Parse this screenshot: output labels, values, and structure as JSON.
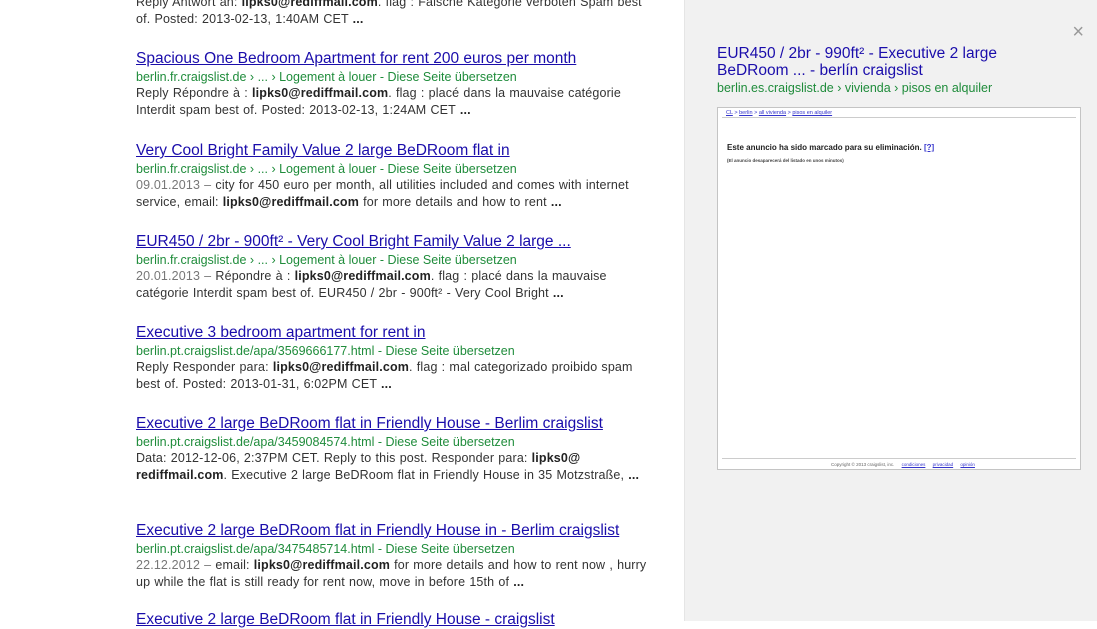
{
  "results": [
    {
      "title": "",
      "url_text": "",
      "translate_label": "",
      "snippet": [
        {
          "t": "Reply Antwort an: "
        },
        {
          "t": "lipks0@rediffmail.com",
          "b": true
        },
        {
          "t": ". flag : Falsche Kategorie verboten Spam best of. Posted: 2013-02-13, 1:40AM CET "
        },
        {
          "t": "...",
          "b": true
        }
      ]
    },
    {
      "title": "Spacious One Bedroom Apartment for rent 200 euros per month",
      "url_text": "berlin.fr.craigslist.de › ... › Logement à louer",
      "translate_label": "Diese Seite übersetzen",
      "snippet": [
        {
          "t": "Reply Répondre à : "
        },
        {
          "t": "lipks0@rediffmail.com",
          "b": true
        },
        {
          "t": ". flag : placé dans la mauvaise catégorie Interdit spam best of. Posted: 2013-02-13, 1:24AM CET "
        },
        {
          "t": "...",
          "b": true
        }
      ]
    },
    {
      "title": "Very Cool Bright Family Value 2 large BeDRoom flat in",
      "url_text": "berlin.fr.craigslist.de › ... › Logement à louer",
      "translate_label": "Diese Seite übersetzen",
      "snippet": [
        {
          "t": "09.01.2013 – ",
          "d": true
        },
        {
          "t": "city for 450 euro per month, all utilities included and comes with internet service, email: "
        },
        {
          "t": "lipks0@rediffmail.com",
          "b": true
        },
        {
          "t": " for more details and how to rent "
        },
        {
          "t": "...",
          "b": true
        }
      ]
    },
    {
      "title": "EUR450 / 2br - 900ft² - Very Cool Bright Family Value 2 large ...",
      "url_text": "berlin.fr.craigslist.de › ... › Logement à louer",
      "translate_label": "Diese Seite übersetzen",
      "snippet": [
        {
          "t": "20.01.2013 – ",
          "d": true
        },
        {
          "t": "Répondre à : "
        },
        {
          "t": "lipks0@rediffmail.com",
          "b": true
        },
        {
          "t": ". flag : placé dans la mauvaise catégorie Interdit spam best of. EUR450 / 2br - 900ft² - Very Cool Bright "
        },
        {
          "t": "...",
          "b": true
        }
      ]
    },
    {
      "title": "Executive 3 bedroom apartment for rent in",
      "url_text": "berlin.pt.craigslist.de/apa/3569666177.html",
      "translate_label": "Diese Seite übersetzen",
      "snippet": [
        {
          "t": "Reply Responder para: "
        },
        {
          "t": "lipks0@rediffmail.com",
          "b": true
        },
        {
          "t": ". flag : mal categorizado proibido spam best of. Posted: 2013-01-31, 6:02PM CET "
        },
        {
          "t": "...",
          "b": true
        }
      ]
    },
    {
      "title": "Executive 2 large BeDRoom flat in Friendly House - Berlim craigslist",
      "url_text": "berlin.pt.craigslist.de/apa/3459084574.html",
      "translate_label": "Diese Seite übersetzen",
      "snippet": [
        {
          "t": "Data: 2012-12-06, 2:37PM CET. Reply to this post. Responder para: "
        },
        {
          "t": "lipks0@ rediffmail.com",
          "b": true
        },
        {
          "t": ". Executive 2 large BeDRoom flat in Friendly House in 35 Motzstraße, "
        },
        {
          "t": "...",
          "b": true
        }
      ]
    },
    {
      "title": "Executive 2 large BeDRoom flat in Friendly House in - Berlim craigslist",
      "url_text": "berlin.pt.craigslist.de/apa/3475485714.html",
      "translate_label": "Diese Seite übersetzen",
      "snippet": [
        {
          "t": "22.12.2012 – ",
          "d": true
        },
        {
          "t": "email: "
        },
        {
          "t": "lipks0@rediffmail.com",
          "b": true
        },
        {
          "t": " for more details and how to rent now , hurry up while the flat is still ready for rent now, move in before 15th of "
        },
        {
          "t": "...",
          "b": true
        }
      ]
    },
    {
      "title": "Executive 2 large BeDRoom flat in Friendly House - craigslist",
      "url_text": "",
      "translate_label": "",
      "snippet": []
    }
  ],
  "preview": {
    "close_glyph": "×",
    "title": "EUR450 / 2br - 990ft² - Executive 2 large BeDRoom ... - berlín craigslist",
    "url_text": "berlin.es.craigslist.de › vivienda › pisos en alquiler",
    "page": {
      "breadcrumb": [
        "CL",
        "berlin",
        "all vivienda",
        "pisos en alquiler"
      ],
      "heading": "Este anuncio ha sido marcado para su eliminación.",
      "heading_link": "[?]",
      "subtext": "(El anuncio desaparecerá del listado en unos minutos)",
      "footer_copyright": "Copyright © 2013 craigslist, inc.",
      "footer_links": [
        "condiciones",
        "privacidad",
        "opinión"
      ]
    }
  }
}
